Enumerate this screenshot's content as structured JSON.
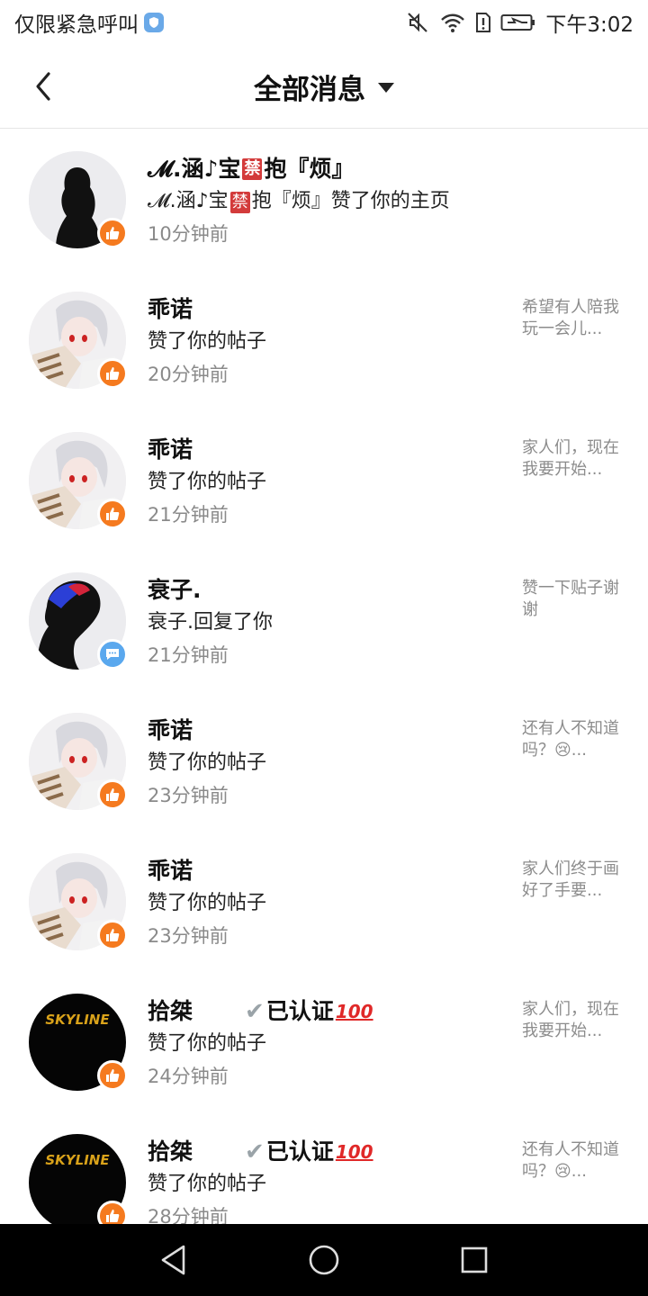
{
  "status_bar": {
    "left_text": "仅限紧急呼叫",
    "time": "下午3:02",
    "icons": [
      "shield-icon",
      "mute-icon",
      "wifi-icon",
      "sim-alert-icon",
      "battery-charging-icon"
    ]
  },
  "header": {
    "title": "全部消息",
    "back_icon": "chevron-left-icon",
    "dropdown_icon": "caret-down-icon"
  },
  "messages": [
    {
      "name_pre": "𝓜.涵♪宝",
      "name_ban": "禁",
      "name_post": "抱『烦』",
      "action_pre": "𝓜.涵♪宝",
      "action_ban": "禁",
      "action_post": "抱『烦』赞了你的主页",
      "time": "10分钟前",
      "badge": "like-icon",
      "preview": ""
    },
    {
      "name": "乖诺",
      "action": "赞了你的帖子",
      "time": "20分钟前",
      "badge": "like-icon",
      "preview": "希望有人陪我玩一会儿..."
    },
    {
      "name": "乖诺",
      "action": "赞了你的帖子",
      "time": "21分钟前",
      "badge": "like-icon",
      "preview": "家人们，现在我要开始..."
    },
    {
      "name": "衰子.",
      "action": "衰子.回复了你",
      "time": "21分钟前",
      "badge": "comment-icon",
      "preview": "赞一下贴子谢谢"
    },
    {
      "name": "乖诺",
      "action": "赞了你的帖子",
      "time": "23分钟前",
      "badge": "like-icon",
      "preview": "还有人不知道吗？😢..."
    },
    {
      "name": "乖诺",
      "action": "赞了你的帖子",
      "time": "23分钟前",
      "badge": "like-icon",
      "preview": "家人们终于画好了手要..."
    },
    {
      "name": "拾桀",
      "verified_check": "✔",
      "verified_text": "已认证",
      "verified_hundred": "100",
      "action": "赞了你的帖子",
      "time": "24分钟前",
      "badge": "like-icon",
      "preview": "家人们，现在我要开始..."
    },
    {
      "name": "拾桀",
      "verified_check": "✔",
      "verified_text": "已认证",
      "verified_hundred": "100",
      "action": "赞了你的帖子",
      "time": "28分钟前",
      "badge": "like-icon",
      "preview": "还有人不知道吗？😢..."
    }
  ],
  "avatar_text": {
    "skyline": "SKYLINE"
  },
  "nav_bar": {
    "icons": [
      "back-triangle-icon",
      "home-circle-icon",
      "recents-square-icon"
    ]
  },
  "colors": {
    "like_badge": "#f57a1f",
    "comment_badge": "#5aa8ee",
    "nav_bar": "#000000"
  }
}
